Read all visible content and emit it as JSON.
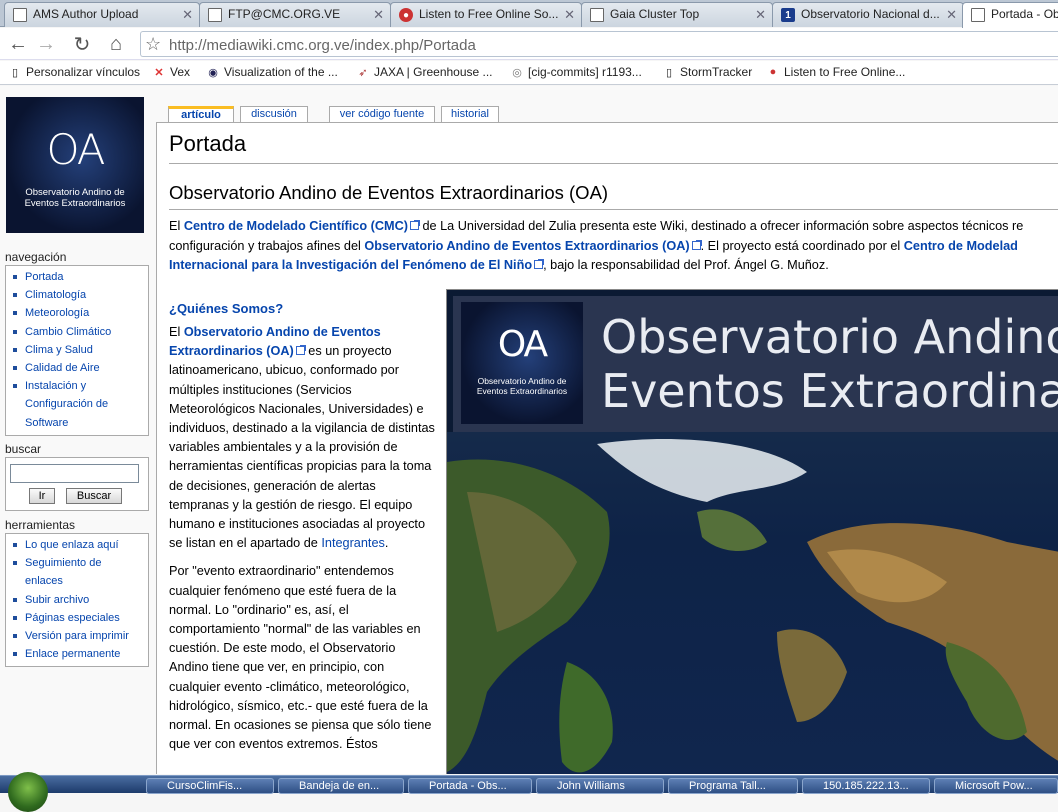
{
  "browser": {
    "tabs": [
      {
        "label": "AMS Author Upload",
        "icon": "document-icon"
      },
      {
        "label": "FTP@CMC.ORG.VE",
        "icon": "document-icon"
      },
      {
        "label": "Listen to Free Online So...",
        "icon": "radio-icon"
      },
      {
        "label": "Gaia Cluster Top",
        "icon": "document-icon"
      },
      {
        "label": "Observatorio Nacional d...",
        "icon": "one-icon"
      },
      {
        "label": "Portada - Obs",
        "icon": "document-icon",
        "active": true
      }
    ],
    "url": {
      "host": "http://mediawiki.cmc.org.ve",
      "path": "/index.php/Portada"
    },
    "bookmarks": [
      {
        "label": "Personalizar vínculos",
        "icon": "page-icon"
      },
      {
        "label": "Vex",
        "icon": "x-icon"
      },
      {
        "label": "Visualization of the ...",
        "icon": "globe-icon"
      },
      {
        "label": "JAXA | Greenhouse ...",
        "icon": "rocket-icon"
      },
      {
        "label": "[cig-commits] r1193...",
        "icon": "spiral-icon"
      },
      {
        "label": "StormTracker",
        "icon": "page-icon"
      },
      {
        "label": "Listen to Free Online...",
        "icon": "radio-icon"
      }
    ]
  },
  "logo": {
    "mark": "OA",
    "line1": "Observatorio Andino de",
    "line2": "Eventos Extraordinarios"
  },
  "nav": {
    "heading": "navegación",
    "items": [
      "Portada",
      "Climatología",
      "Meteorología",
      "Cambio Climático",
      "Clima y Salud",
      "Calidad de Aire",
      "Instalación y",
      "Configuración de",
      "Software"
    ]
  },
  "search": {
    "heading": "buscar",
    "go_label": "Ir",
    "search_label": "Buscar"
  },
  "tools": {
    "heading": "herramientas",
    "items": [
      "Lo que enlaza aquí",
      "Seguimiento de",
      "enlaces",
      "Subir archivo",
      "Páginas especiales",
      "Versión para imprimir",
      "Enlace permanente"
    ]
  },
  "content_tabs": {
    "article": "artículo",
    "discussion": "discusión",
    "source": "ver código fuente",
    "history": "historial"
  },
  "page": {
    "title": "Portada",
    "subtitle": "Observatorio Andino de Eventos Extraordinarios (OA)",
    "intro": {
      "l1a": "El ",
      "l1b": "Centro de Modelado Científico (CMC)",
      "l1c": " de La Universidad del Zulia presenta este Wiki, destinado a ofrecer información sobre aspectos técnicos re",
      "l2a": "configuración y trabajos afines del ",
      "l2b": "Observatorio Andino de Eventos Extraordinarios (OA)",
      "l2c": ". El proyecto está coordinado por el ",
      "l2d": "Centro de Modelad",
      "l3a": "Internacional para la Investigación del Fenómeno de El Niño",
      "l3b": ", bajo la responsabilidad del Prof. Ángel G. Muñoz."
    },
    "quienes": "¿Quiénes Somos?",
    "p1a": "El ",
    "p1b": "Observatorio Andino de Eventos Extraordinarios (OA)",
    "p1c": " es un proyecto latinoamericano, ubicuo, conformado por múltiples instituciones (Servicios Meteorológicos Nacionales, Universidades) e individuos, destinado a la vigilancia de distintas variables ambientales y a la provisión de herramientas científicas propicias para la toma de decisiones, generación de alertas tempranas y la gestión de riesgo. El equipo humano e instituciones asociadas al proyecto se listan en el apartado de ",
    "p1d": "Integrantes",
    "p1e": ".",
    "p2": "Por \"evento extraordinario\" entendemos cualquier fenómeno que esté fuera de la normal. Lo \"ordinario\" es, así, el comportamiento \"normal\" de las variables en cuestión. De este modo, el Observatorio Andino tiene que ver, en principio, con cualquier evento -climático, meteorológico, hidrológico, sísmico, etc.- que esté fuera de la normal. En ocasiones se piensa que sólo tiene que ver con eventos extremos. Éstos"
  },
  "banner": {
    "line1": "Observatorio Andino d",
    "line2": "Eventos Extraordinari"
  },
  "taskbar": {
    "items": [
      "CursoClimFis...",
      "Bandeja de en...",
      "Portada - Obs...",
      "John Williams",
      "Programa Tall...",
      "150.185.222.13...",
      "Microsoft Pow..."
    ]
  }
}
